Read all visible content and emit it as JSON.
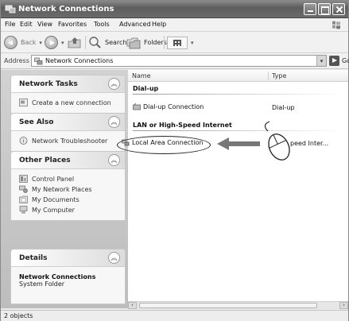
{
  "window": {
    "title": "Network Connections"
  },
  "menubar": {
    "items": [
      "File",
      "Edit",
      "View",
      "Favorites",
      "Tools",
      "Advanced",
      "Help"
    ]
  },
  "toolbar": {
    "back_label": "Back",
    "search_label": "Search",
    "folders_label": "Folders"
  },
  "address": {
    "label": "Address",
    "value": "Network Connections",
    "go_label": "Go"
  },
  "taskpane": {
    "network_tasks": {
      "title": "Network Tasks",
      "items": [
        "Create a new connection"
      ]
    },
    "see_also": {
      "title": "See Also",
      "items": [
        "Network Troubleshooter"
      ]
    },
    "other_places": {
      "title": "Other Places",
      "items": [
        "Control Panel",
        "My Network Places",
        "My Documents",
        "My Computer"
      ]
    },
    "details": {
      "title": "Details",
      "name": "Network Connections",
      "type": "System Folder"
    }
  },
  "content": {
    "columns": [
      "Name",
      "Type"
    ],
    "groups": [
      {
        "title": "Dial-up",
        "rows": [
          {
            "name": "Dial-up Connection",
            "type": "Dial-up"
          }
        ]
      },
      {
        "title": "LAN or High-Speed Internet",
        "rows": [
          {
            "name": "Local Area Connection",
            "type": "peed Inter..."
          }
        ]
      }
    ]
  },
  "status": {
    "text": "2 objects"
  },
  "icons": [
    "app-network-icon",
    "windows-logo-icon",
    "back-icon",
    "forward-icon",
    "up-folder-icon",
    "search-icon",
    "folders-icon",
    "views-icon",
    "network-icon",
    "go-icon",
    "chevron-up-icon",
    "new-connection-icon",
    "help-icon",
    "control-panel-icon",
    "network-places-icon",
    "documents-icon",
    "computer-icon",
    "modem-icon",
    "lan-icon",
    "pointer-arrow-icon",
    "mouse-icon"
  ]
}
